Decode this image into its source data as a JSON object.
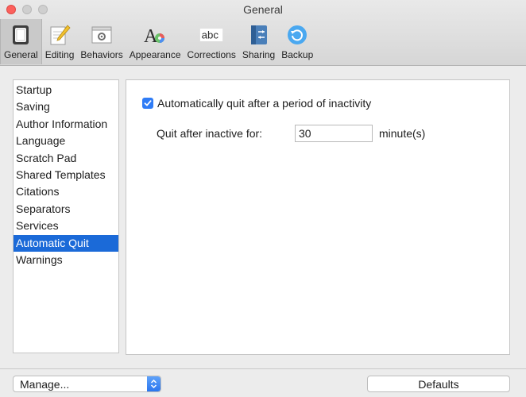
{
  "window": {
    "title": "General"
  },
  "toolbar": {
    "tabs": [
      {
        "label": "General",
        "icon": "switch-icon",
        "active": true
      },
      {
        "label": "Editing",
        "icon": "pencil-icon"
      },
      {
        "label": "Behaviors",
        "icon": "gear-window-icon"
      },
      {
        "label": "Appearance",
        "icon": "font-palette-icon"
      },
      {
        "label": "Corrections",
        "icon": "abc-icon",
        "icon_text": "abc"
      },
      {
        "label": "Sharing",
        "icon": "binder-icon"
      },
      {
        "label": "Backup",
        "icon": "backup-icon"
      }
    ]
  },
  "sidebar": {
    "items": [
      {
        "label": "Startup"
      },
      {
        "label": "Saving"
      },
      {
        "label": "Author Information"
      },
      {
        "label": "Language"
      },
      {
        "label": "Scratch Pad"
      },
      {
        "label": "Shared Templates"
      },
      {
        "label": "Citations"
      },
      {
        "label": "Separators"
      },
      {
        "label": "Services"
      },
      {
        "label": "Automatic Quit",
        "selected": true
      },
      {
        "label": "Warnings"
      }
    ]
  },
  "panel": {
    "auto_quit": {
      "label": "Automatically quit after a period of inactivity",
      "checked": true
    },
    "inactive": {
      "label": "Quit after inactive for:",
      "value": "30",
      "unit": "minute(s)"
    }
  },
  "footer": {
    "manage_label": "Manage...",
    "defaults_label": "Defaults"
  },
  "colors": {
    "accent": "#1b6ad8",
    "checkbox": "#2f7cf6",
    "close": "#fc605c"
  }
}
